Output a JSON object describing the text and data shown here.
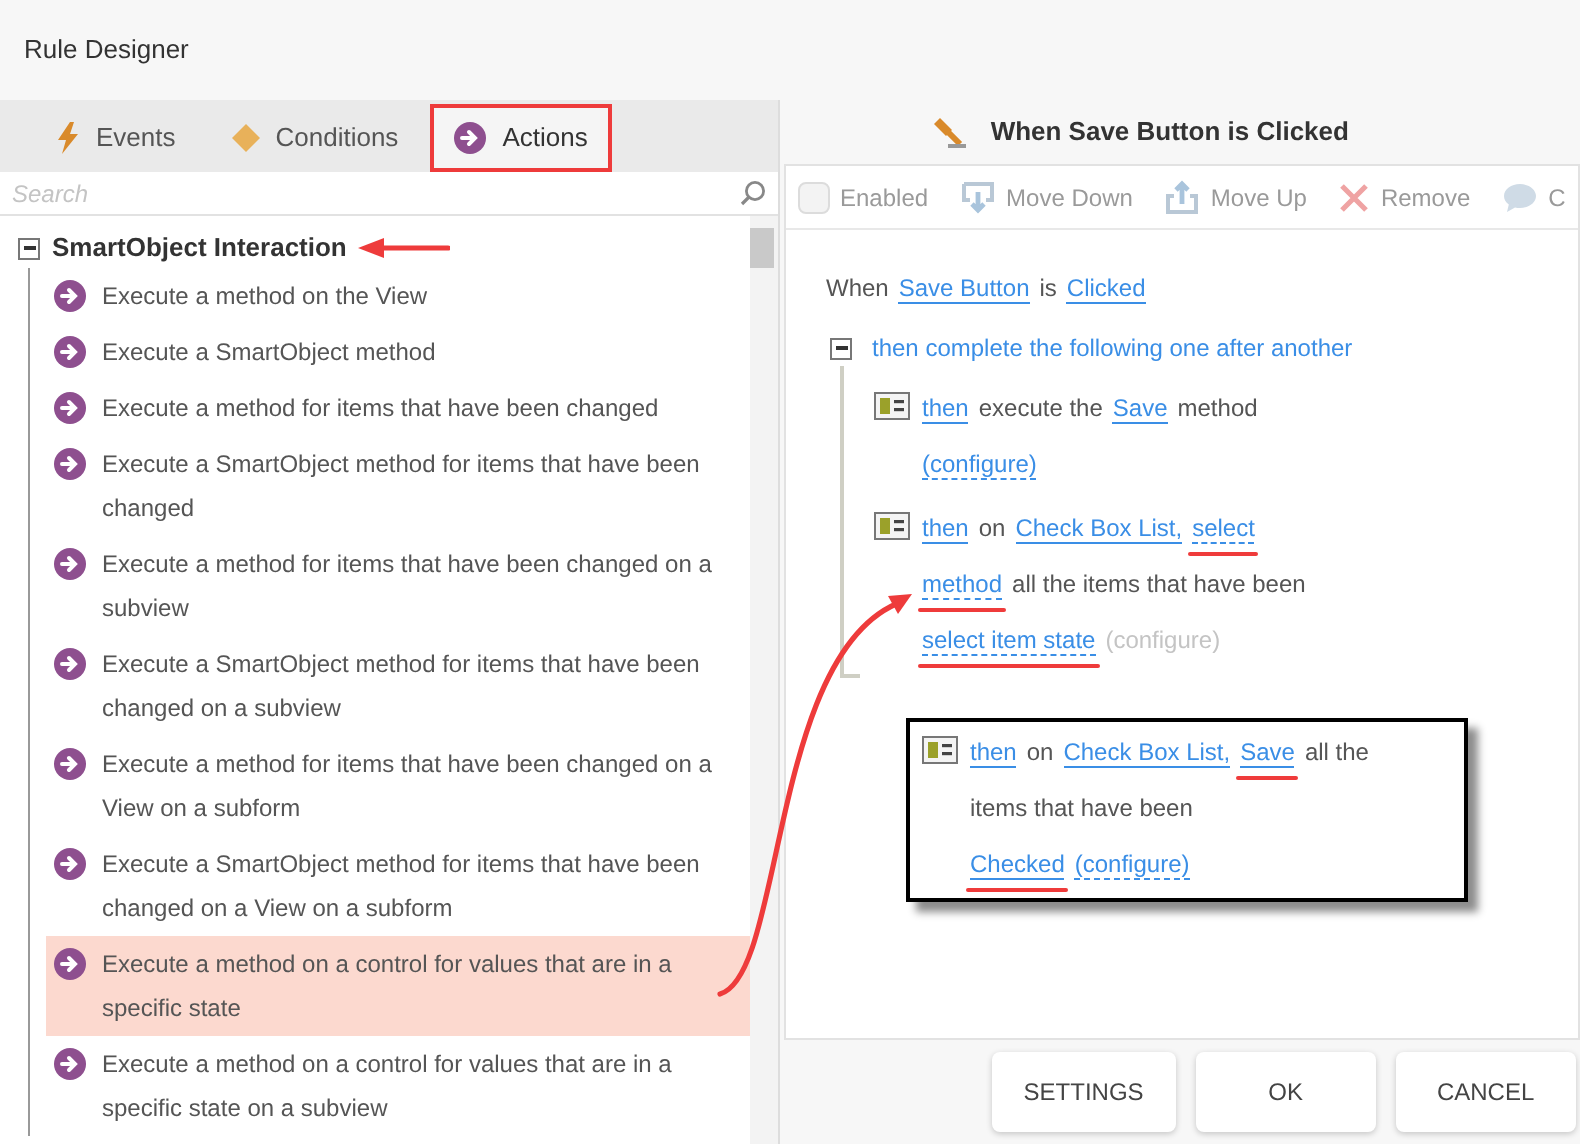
{
  "window": {
    "title": "Rule Designer"
  },
  "tabs": [
    {
      "label": "Events",
      "kind": "events",
      "selected": false,
      "outlined": false
    },
    {
      "label": "Conditions",
      "kind": "conditions",
      "selected": false,
      "outlined": false
    },
    {
      "label": "Actions",
      "kind": "actions",
      "selected": true,
      "outlined": true
    }
  ],
  "search": {
    "placeholder": "Search"
  },
  "tree": {
    "label": "SmartObject Interaction",
    "expanded": true,
    "pointed": true,
    "children": [
      {
        "label": "Execute a method on the View",
        "selected": false
      },
      {
        "label": "Execute a SmartObject method",
        "selected": false
      },
      {
        "label": "Execute a method for items that have been changed",
        "selected": false
      },
      {
        "label": "Execute a SmartObject method for items that have been changed",
        "selected": false
      },
      {
        "label": "Execute a method for items that have been changed on a subview",
        "selected": false
      },
      {
        "label": "Execute a SmartObject method for items that have been changed on a subview",
        "selected": false
      },
      {
        "label": "Execute a method for items that have been changed on a View on a subform",
        "selected": false
      },
      {
        "label": "Execute a SmartObject method for items that have been changed on a View on a subform",
        "selected": false
      },
      {
        "label": "Execute a method on a control for values that are in a specific state",
        "selected": true
      },
      {
        "label": "Execute a method on a control for values that are in a specific state on a subview",
        "selected": false
      }
    ]
  },
  "rule": {
    "title": "When Save Button is Clicked",
    "toolbar": [
      {
        "kind": "checkbox",
        "label": "Enabled",
        "checked": false,
        "disabled": true
      },
      {
        "kind": "down",
        "label": "Move Down",
        "disabled": true
      },
      {
        "kind": "up",
        "label": "Move Up",
        "disabled": true
      },
      {
        "kind": "remove",
        "label": "Remove",
        "disabled": true
      },
      {
        "kind": "comment",
        "label": "C",
        "disabled": true
      }
    ],
    "event": [
      [
        {
          "kind": "text",
          "text": "When",
          "marked": false
        },
        {
          "kind": "link",
          "text": "Save Button",
          "marked": false
        },
        {
          "kind": "text",
          "text": "is",
          "marked": false
        },
        {
          "kind": "link",
          "text": "Clicked",
          "marked": false
        }
      ]
    ],
    "group": {
      "label": "then complete the following one after another",
      "expanded": true
    },
    "actions": [
      {
        "lines": [
          [
            {
              "kind": "link",
              "text": "then",
              "marked": false
            },
            {
              "kind": "text",
              "text": "execute the",
              "marked": false
            },
            {
              "kind": "link",
              "text": "Save",
              "marked": false
            },
            {
              "kind": "text",
              "text": "method",
              "marked": false
            }
          ],
          [
            {
              "kind": "option",
              "text": "(configure)",
              "marked": false
            }
          ]
        ]
      },
      {
        "lines": [
          [
            {
              "kind": "link",
              "text": "then",
              "marked": false
            },
            {
              "kind": "text",
              "text": "on",
              "marked": false
            },
            {
              "kind": "link",
              "text": "Check Box List,",
              "marked": false
            },
            {
              "kind": "option",
              "text": "select",
              "marked": true
            }
          ],
          [
            {
              "kind": "option",
              "text": "method",
              "marked": true
            },
            {
              "kind": "text",
              "text": "all the items that have been",
              "marked": false
            }
          ],
          [
            {
              "kind": "option",
              "text": "select item state",
              "marked": true
            },
            {
              "kind": "muted",
              "text": "(configure)",
              "marked": false
            }
          ]
        ]
      }
    ],
    "callout": {
      "lines": [
        [
          {
            "kind": "link",
            "text": "then",
            "marked": false
          },
          {
            "kind": "text",
            "text": "on",
            "marked": false
          },
          {
            "kind": "link",
            "text": "Check Box List,",
            "marked": false
          },
          {
            "kind": "link",
            "text": "Save",
            "marked": true
          },
          {
            "kind": "text",
            "text": "all the",
            "marked": false
          }
        ],
        [
          {
            "kind": "text",
            "text": "items that have been",
            "marked": false
          }
        ],
        [
          {
            "kind": "link",
            "text": "Checked",
            "marked": true
          },
          {
            "kind": "option",
            "text": "(configure)",
            "marked": false
          }
        ]
      ]
    }
  },
  "buttons": [
    "SETTINGS",
    "OK",
    "CANCEL"
  ]
}
